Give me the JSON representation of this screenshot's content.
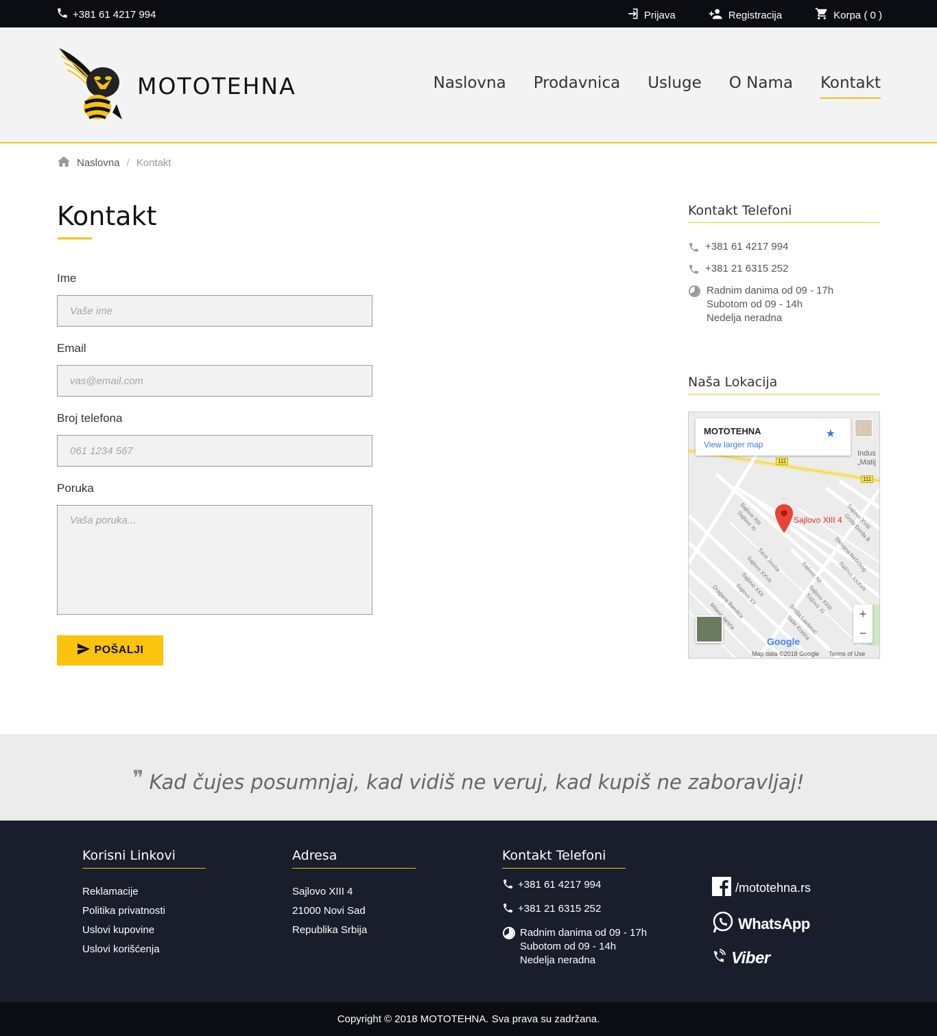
{
  "topbar": {
    "phone": "+381 61 4217 994",
    "login": "Prijava",
    "register": "Registracija",
    "cart": "Korpa ( 0 )"
  },
  "header": {
    "brand": "MOTOTEHNA",
    "nav": [
      "Naslovna",
      "Prodavnica",
      "Usluge",
      "O Nama",
      "Kontakt"
    ],
    "active_nav": "Kontakt"
  },
  "breadcrumb": {
    "home": "Naslovna",
    "current": "Kontakt"
  },
  "form": {
    "title": "Kontakt",
    "name_label": "Ime",
    "name_placeholder": "Vaše ime",
    "email_label": "Email",
    "email_placeholder": "vas@email.com",
    "phone_label": "Broj telefona",
    "phone_placeholder": "061 1234 567",
    "message_label": "Poruka",
    "message_placeholder": "Vaša poruka...",
    "submit_label": "POŠALJI"
  },
  "sidebar": {
    "phones_title": "Kontakt Telefoni",
    "phone1": "+381 61 4217 994",
    "phone2": "+381 21 6315 252",
    "hours1": "Radnim danima od 09 - 17h",
    "hours2": "Subotom od 09 - 14h",
    "hours3": "Nedelja neradna",
    "location_title": "Naša Lokacija"
  },
  "map": {
    "place_name": "MOTOTEHNA",
    "larger_map_link": "View larger map",
    "pin_label": "Sajlovo XIII 4",
    "road_badge": "111",
    "poi_label": "Indus „Matij",
    "map_data": "Map data ©2018 Google",
    "terms": "Terms of Use",
    "google": "Google",
    "zoom_in": "+",
    "zoom_out": "−",
    "streets": [
      "Sajlovo XIII",
      "Sajlovo XI",
      "Save Jovića",
      "Sajlovo XXVII",
      "Sajlovo XXII",
      "Sajlovo XX",
      "Dragana Bandića",
      "Milana Janića",
      "Sajlovo XII",
      "Sajlovo XXIII",
      "Sajlovo XI",
      "Siniša Laušević",
      "Saše Krstića",
      "Stevana Nešićkog",
      "Sajlovo XXXVII",
      "Sajlovo XVIII",
      "Grofa Đorđa B"
    ]
  },
  "quote": {
    "text": "Kad čujes posumnjaj, kad vidiš ne veruj, kad kupiš ne zaboravljaj!"
  },
  "footer": {
    "links_title": "Korisni Linkovi",
    "links": [
      "Reklamacije",
      "Politika privatnosti",
      "Uslovi kupovine",
      "Uslovi korišćenja"
    ],
    "address_title": "Adresa",
    "address": [
      "Sajlovo XIII 4",
      "21000 Novi Sad",
      "Republika Srbija"
    ],
    "phones_title": "Kontakt Telefoni",
    "phone1": "+381 61 4217 994",
    "phone2": "+381 21 6315 252",
    "hours1": "Radnim danima od 09 - 17h",
    "hours2": "Subotom od 09 - 14h",
    "hours3": "Nedelja neradna",
    "facebook": "/mototehna.rs",
    "whatsapp": "WhatsApp",
    "viber": "Viber"
  },
  "copyright": "Copyright © 2018 MOTOTEHNA. Sva prava su zadržana.",
  "colors": {
    "accent": "#f2c314",
    "button": "#fbc30e",
    "dark": "#0b0d12",
    "footer": "#1a1d2b"
  }
}
